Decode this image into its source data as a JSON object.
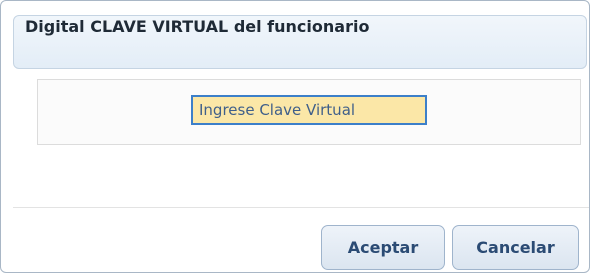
{
  "dialog": {
    "title": "Digital CLAVE VIRTUAL del funcionario",
    "password_field": {
      "placeholder": "Ingrese Clave Virtual",
      "value": ""
    },
    "buttons": {
      "accept_label": "Aceptar",
      "cancel_label": "Cancelar"
    }
  }
}
